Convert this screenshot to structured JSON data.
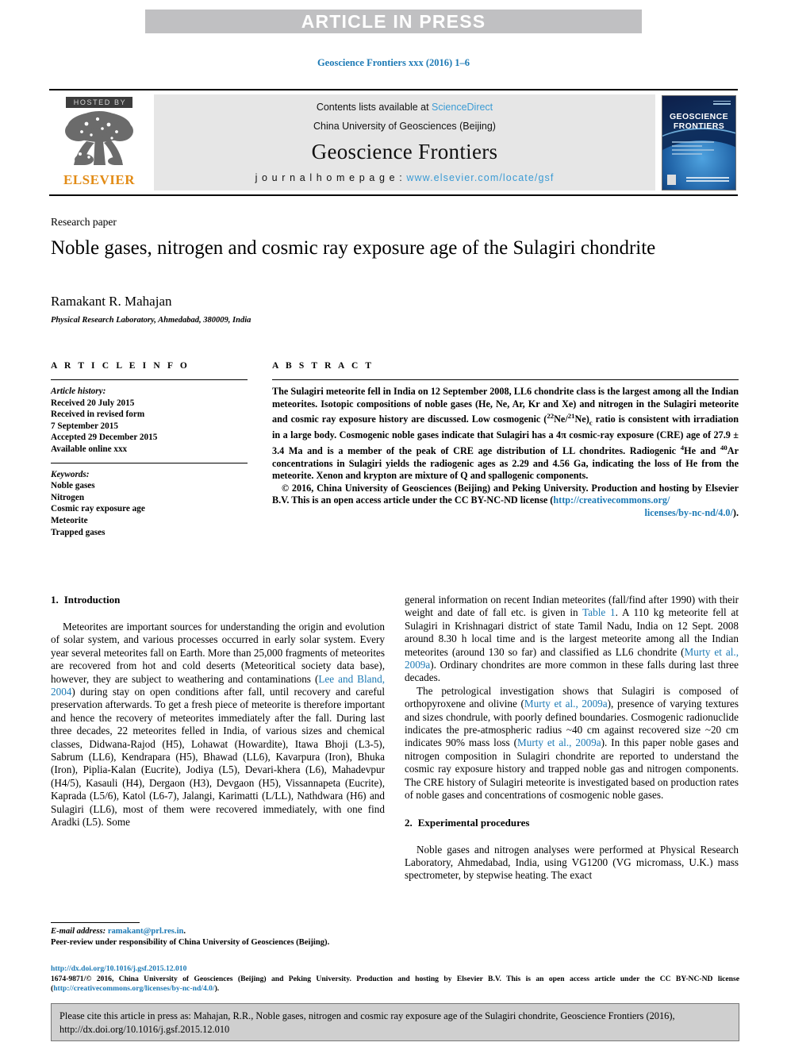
{
  "banner": {
    "text": "ARTICLE IN PRESS"
  },
  "running_head": {
    "text": "Geoscience Frontiers xxx (2016) 1–6"
  },
  "masthead": {
    "hosted_by": "HOSTED BY",
    "elsevier": "ELSEVIER",
    "contents_prefix": "Contents lists available at ",
    "sciencedirect": "ScienceDirect",
    "publisher": "China University of Geosciences (Beijing)",
    "journal_title": "Geoscience Frontiers",
    "homepage_label": "j o u r n a l   h o m e p a g e :  ",
    "homepage_url": "www.elsevier.com/locate/gsf",
    "cover_title_line1": "GEOSCIENCE",
    "cover_title_line2": "FRONTIERS"
  },
  "article": {
    "kind": "Research paper",
    "title": "Noble gases, nitrogen and cosmic ray exposure age of the Sulagiri chondrite",
    "authors": "Ramakant R. Mahajan",
    "affiliation": "Physical Research Laboratory, Ahmedabad, 380009, India"
  },
  "article_info": {
    "heading": "A R T I C L E   I N F O",
    "history_label": "Article history:",
    "history": [
      "Received 20 July 2015",
      "Received in revised form",
      "7 September 2015",
      "Accepted 29 December 2015",
      "Available online xxx"
    ],
    "keywords_label": "Keywords:",
    "keywords": [
      "Noble gases",
      "Nitrogen",
      "Cosmic ray exposure age",
      "Meteorite",
      "Trapped gases"
    ]
  },
  "abstract": {
    "heading": "A B S T R A C T",
    "p1_a": "The Sulagiri meteorite fell in India on 12 September 2008, LL6 chondrite class is the largest among all the Indian meteorites. Isotopic compositions of noble gases (He, Ne, Ar, Kr and Xe) and nitrogen in the Sulagiri meteorite and cosmic ray exposure history are discussed. Low cosmogenic (",
    "p1_ne22": "22",
    "p1_b": "Ne/",
    "p1_ne21": "21",
    "p1_c": "Ne)",
    "p1_sub_c": "c",
    "p1_d": " ratio is consistent with irradiation in a large body. Cosmogenic noble gases indicate that Sulagiri has a 4π cosmic-ray exposure (CRE) age of 27.9 ± 3.4 Ma and is a member of the peak of CRE age distribution of LL chondrites. Radiogenic ",
    "p1_he4": "4",
    "p1_e": "He and ",
    "p1_ar40": "40",
    "p1_f": "Ar concentrations in Sulagiri yields the radiogenic ages as 2.29 and 4.56 Ga, indicating the loss of He from the meteorite. Xenon and krypton are mixture of Q and spallogenic components.",
    "copyright_a": "© 2016, China University of Geosciences (Beijing) and Peking University. Production and hosting by Elsevier B.V. This is an open access article under the CC BY-NC-ND license (",
    "copyright_link1": "http://creativecommons.org/",
    "copyright_link2": "licenses/by-nc-nd/4.0/",
    "copyright_b": ")."
  },
  "sections": {
    "intro": {
      "number": "1.",
      "title": "Introduction",
      "p1_a": "Meteorites are important sources for understanding the origin and evolution of solar system, and various processes occurred in early solar system. Every year several meteorites fall on Earth. More than 25,000 fragments of meteorites are recovered from hot and cold deserts (Meteoritical society data base), however, they are subject to weathering and contaminations (",
      "p1_cite1": "Lee and Bland, 2004",
      "p1_b": ") during stay on open conditions after fall, until recovery and careful preservation afterwards. To get a fresh piece of meteorite is therefore important and hence the recovery of meteorites immediately after the fall. During last three decades, 22 meteorites felled in India, of various sizes and chemical classes, Didwana-Rajod (H5), Lohawat (Howardite), Itawa Bhoji (L3-5), Sabrum (LL6), Kendrapara (H5), Bhawad (LL6), Kavarpura (Iron), Bhuka (Iron), Piplia-Kalan (Eucrite), Jodiya (L5), Devari-khera (L6), Mahadevpur (H4/5), Kasauli (H4), Dergaon (H3), Devgaon (H5), Vissannapeta (Eucrite), Kaprada (L5/6), Katol (L6-7), Jalangi, Karimatti (L/LL), Nathdwara (H6) and Sulagiri (LL6), most of them were recovered immediately, with one find Aradki (L5). Some"
    },
    "intro_right": {
      "p2_a": "general information on recent Indian meteorites (fall/find after 1990) with their weight and date of fall etc. is given in ",
      "p2_table_ref": "Table 1",
      "p2_b": ". A 110 kg meteorite fell at Sulagiri in Krishnagari district of state Tamil Nadu, India on 12 Sept. 2008 around 8.30 h local time and is the largest meteorite among all the Indian meteorites (around 130 so far) and classified as LL6 chondrite (",
      "p2_cite1": "Murty et al., 2009a",
      "p2_c": "). Ordinary chondrites are more common in these falls during last three decades.",
      "p3_a": "The petrological investigation shows that Sulagiri is composed of orthopyroxene and olivine (",
      "p3_cite1": "Murty et al., 2009a",
      "p3_b": "), presence of varying textures and sizes chondrule, with poorly defined boundaries. Cosmogenic radionuclide indicates the pre-atmospheric radius ~40 cm against recovered size ~20 cm indicates 90% mass loss (",
      "p3_cite2": "Murty et al., 2009a",
      "p3_c": "). In this paper noble gases and nitrogen composition in Sulagiri chondrite are reported to understand the cosmic ray exposure history and trapped noble gas and nitrogen components. The CRE history of Sulagiri meteorite is investigated based on production rates of noble gases and concentrations of cosmogenic noble gases."
    },
    "experimental": {
      "number": "2.",
      "title": "Experimental procedures",
      "p1": "Noble gases and nitrogen analyses were performed at Physical Research Laboratory, Ahmedabad, India, using VG1200 (VG micromass, U.K.) mass spectrometer, by stepwise heating. The exact"
    }
  },
  "footnote": {
    "email_label": "E-mail address:",
    "email": "ramakant@prl.res.in",
    "email_tail": ".",
    "peer_review": "Peer-review under responsibility of China University of Geosciences (Beijing)."
  },
  "bottom": {
    "doi": "http://dx.doi.org/10.1016/j.gsf.2015.12.010",
    "copyright_a": "1674-9871/© 2016, China University of Geosciences (Beijing) and Peking University. Production and hosting by Elsevier B.V. This is an open access article under the CC BY-NC-ND license (",
    "copyright_link": "http://creativecommons.org/licenses/by-nc-nd/4.0/",
    "copyright_b": ")."
  },
  "cite_box": {
    "text": "Please cite this article in press as: Mahajan, R.R., Noble gases, nitrogen and cosmic ray exposure age of the Sulagiri chondrite, Geoscience Frontiers (2016), http://dx.doi.org/10.1016/j.gsf.2015.12.010"
  },
  "colors": {
    "link": "#1d7ab5",
    "banner_bg": "#c0c0c2",
    "masthead_bg": "#e6e6e6",
    "elsevier_orange": "#e28b15",
    "cite_box_bg": "#cfcfcf"
  }
}
